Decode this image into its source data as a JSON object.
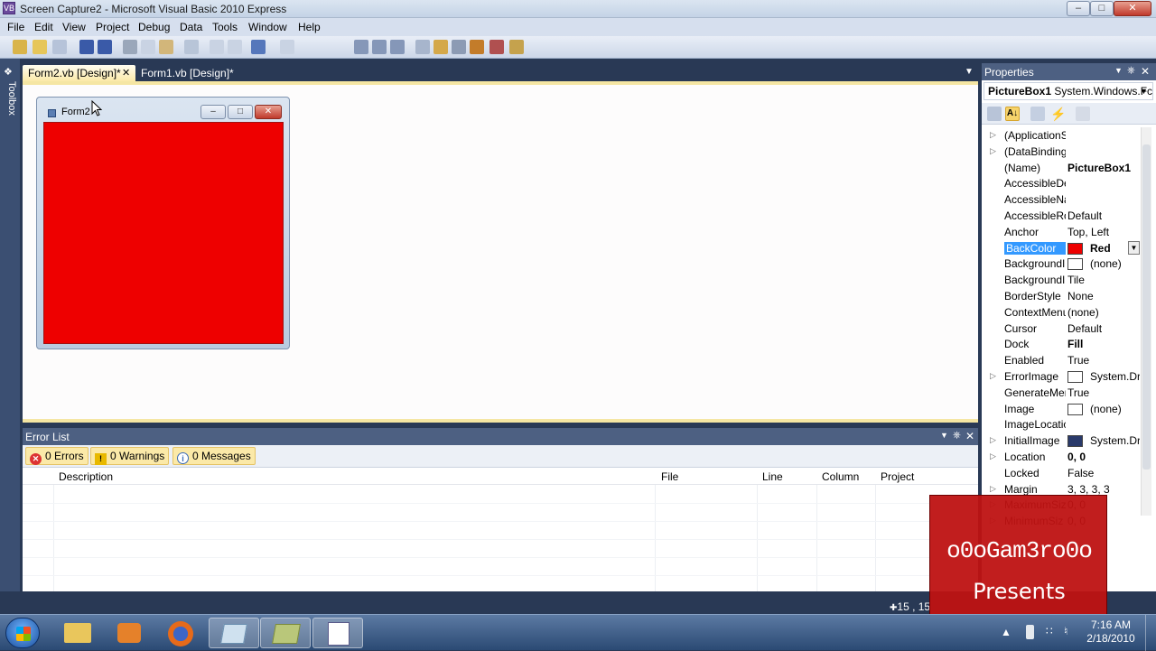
{
  "window": {
    "title": "Screen Capture2 - Microsoft Visual Basic 2010 Express"
  },
  "menu": [
    "File",
    "Edit",
    "View",
    "Project",
    "Debug",
    "Data",
    "Tools",
    "Window",
    "Help"
  ],
  "toolbox_label": "Toolbox",
  "tabs": [
    {
      "label": "Form2.vb [Design]*"
    },
    {
      "label": "Form1.vb [Design]*"
    }
  ],
  "designer": {
    "form_title": "Form2",
    "picturebox_color": "#ee0000"
  },
  "error_list": {
    "title": "Error List",
    "buttons": {
      "errors": "0 Errors",
      "warnings": "0 Warnings",
      "messages": "0 Messages"
    },
    "columns": {
      "description": "Description",
      "file": "File",
      "line": "Line",
      "column": "Column",
      "project": "Project"
    }
  },
  "properties": {
    "title": "Properties",
    "object_name": "PictureBox1",
    "object_type": "System.Windows.Fc",
    "rows": [
      {
        "name": "(ApplicationS",
        "value": "",
        "expander": true
      },
      {
        "name": "(DataBinding",
        "value": "",
        "expander": true
      },
      {
        "name": "(Name)",
        "value": "PictureBox1",
        "bold": true
      },
      {
        "name": "AccessibleDe",
        "value": ""
      },
      {
        "name": "AccessibleNa",
        "value": ""
      },
      {
        "name": "AccessibleRo",
        "value": "Default"
      },
      {
        "name": "Anchor",
        "value": "Top, Left"
      },
      {
        "name": "BackColor",
        "value": "Red",
        "bold": true,
        "swatch": "#ee0000",
        "selected": true
      },
      {
        "name": "BackgroundIi",
        "value": "(none)",
        "swatch": "#ffffff"
      },
      {
        "name": "BackgroundIi",
        "value": "Tile"
      },
      {
        "name": "BorderStyle",
        "value": "None"
      },
      {
        "name": "ContextMenu",
        "value": "(none)"
      },
      {
        "name": "Cursor",
        "value": "Default"
      },
      {
        "name": "Dock",
        "value": "Fill",
        "bold": true
      },
      {
        "name": "Enabled",
        "value": "True"
      },
      {
        "name": "ErrorImage",
        "value": "System.Dr",
        "swatch": "#ffffff",
        "expander": true
      },
      {
        "name": "GenerateMen",
        "value": "True"
      },
      {
        "name": "Image",
        "value": "(none)",
        "swatch": "#ffffff"
      },
      {
        "name": "ImageLocatic",
        "value": ""
      },
      {
        "name": "InitialImage",
        "value": "System.Dr",
        "swatch": "#2a3a6a",
        "expander": true
      },
      {
        "name": "Location",
        "value": "0, 0",
        "bold": true,
        "expander": true
      },
      {
        "name": "Locked",
        "value": "False"
      },
      {
        "name": "Margin",
        "value": "3, 3, 3, 3",
        "expander": true
      },
      {
        "name": "MaximumSiz",
        "value": "0, 0",
        "expander": true
      },
      {
        "name": "MinimumSiz",
        "value": "0, 0",
        "expander": true
      }
    ]
  },
  "status": {
    "position": "15 , 15"
  },
  "watermark": {
    "line1": "o0oGam3ro0o",
    "line2": "Presents"
  },
  "clock": {
    "time": "7:16 AM",
    "date": "2/18/2010"
  }
}
